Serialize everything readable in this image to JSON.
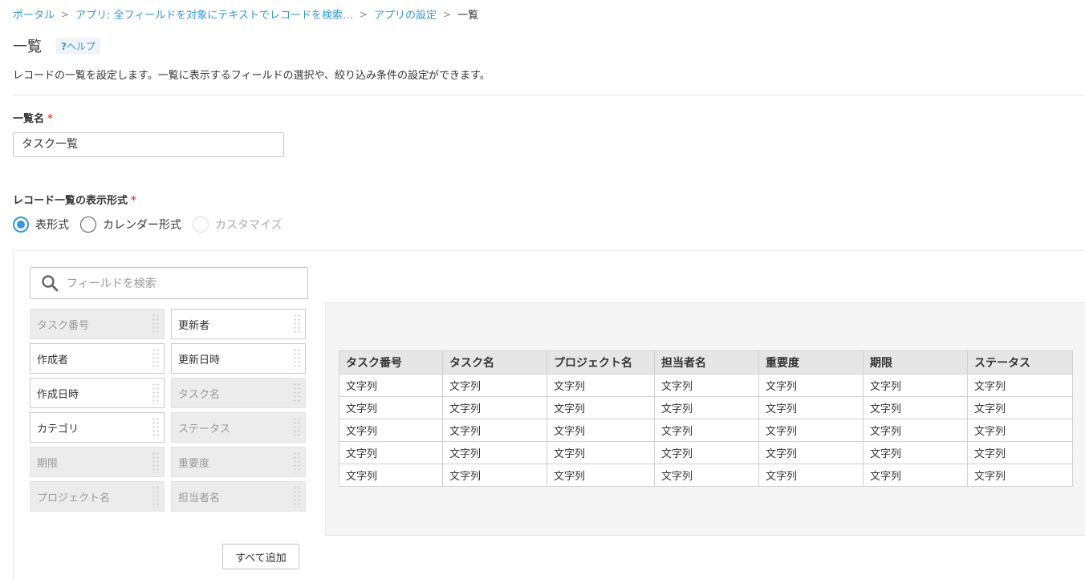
{
  "breadcrumb": {
    "portal": "ポータル",
    "app": "アプリ: 全フィールドを対象にテキストでレコードを検索…",
    "settings": "アプリの設定",
    "current": "一覧"
  },
  "title": "一覧",
  "help": {
    "icon": "?",
    "label": "ヘルプ"
  },
  "description": "レコードの一覧を設定します。一覧に表示するフィールドの選択や、絞り込み条件の設定ができます。",
  "name_section": {
    "label": "一覧名",
    "required": "*",
    "value": "タスク一覧"
  },
  "format_section": {
    "label": "レコード一覧の表示形式",
    "required": "*",
    "options": [
      "表形式",
      "カレンダー形式",
      "カスタマイズ"
    ],
    "selected": "表形式"
  },
  "search": {
    "placeholder": "フィールドを検索",
    "icon": "search-icon"
  },
  "fields": [
    {
      "label": "タスク番号",
      "used": true
    },
    {
      "label": "更新者",
      "used": false
    },
    {
      "label": "作成者",
      "used": false
    },
    {
      "label": "更新日時",
      "used": false
    },
    {
      "label": "作成日時",
      "used": false
    },
    {
      "label": "タスク名",
      "used": true
    },
    {
      "label": "カテゴリ",
      "used": false
    },
    {
      "label": "ステータス",
      "used": true
    },
    {
      "label": "期限",
      "used": true
    },
    {
      "label": "重要度",
      "used": true
    },
    {
      "label": "プロジェクト名",
      "used": true
    },
    {
      "label": "担当者名",
      "used": true
    }
  ],
  "add_all_label": "すべて追加",
  "table": {
    "columns": [
      "タスク番号",
      "タスク名",
      "プロジェクト名",
      "担当者名",
      "重要度",
      "期限",
      "ステータス"
    ],
    "rows": [
      [
        "文字列",
        "文字列",
        "文字列",
        "文字列",
        "文字列",
        "文字列",
        "文字列"
      ],
      [
        "文字列",
        "文字列",
        "文字列",
        "文字列",
        "文字列",
        "文字列",
        "文字列"
      ],
      [
        "文字列",
        "文字列",
        "文字列",
        "文字列",
        "文字列",
        "文字列",
        "文字列"
      ],
      [
        "文字列",
        "文字列",
        "文字列",
        "文字列",
        "文字列",
        "文字列",
        "文字列"
      ],
      [
        "文字列",
        "文字列",
        "文字列",
        "文字列",
        "文字列",
        "文字列",
        "文字列"
      ]
    ]
  }
}
